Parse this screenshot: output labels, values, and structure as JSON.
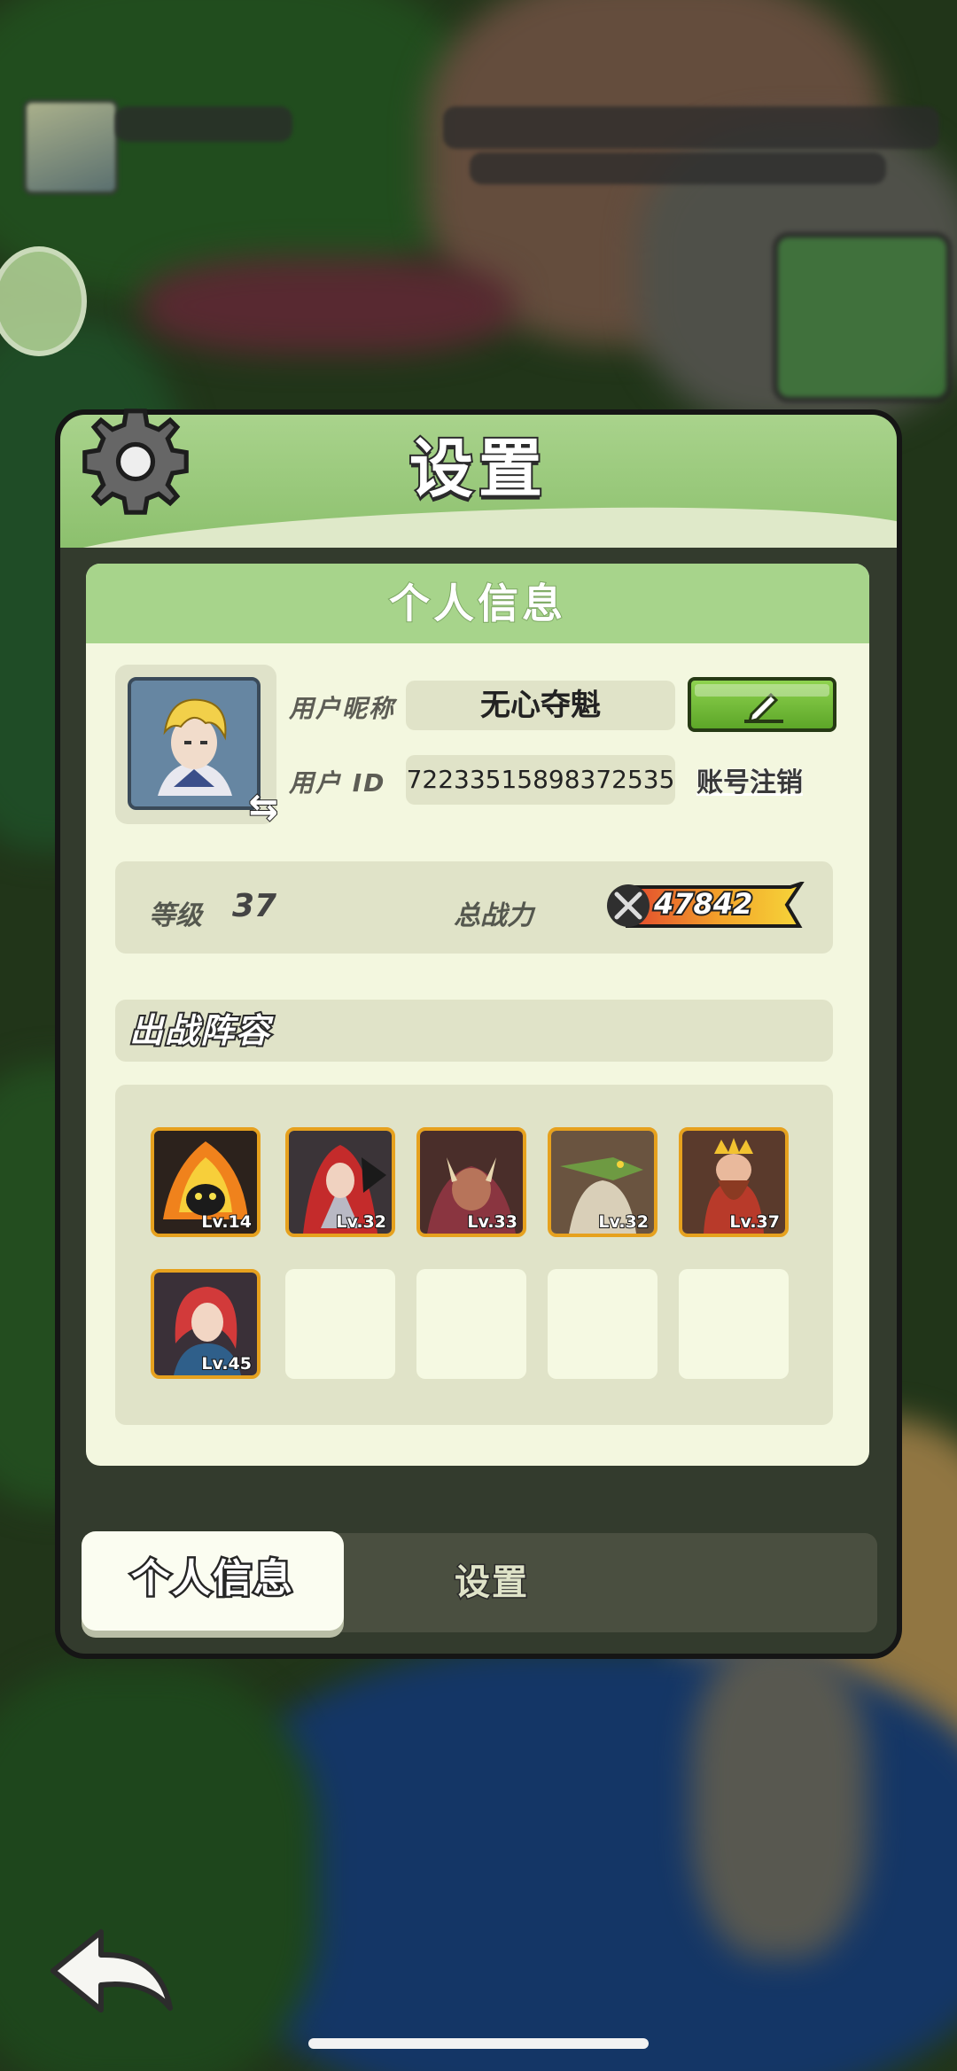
{
  "panel": {
    "title": "设置"
  },
  "profile": {
    "section_title": "个人信息",
    "nickname_label": "用户昵称",
    "nickname": "无心夺魁",
    "id_label": "用户  ID",
    "user_id": "72233515898372535",
    "cancel_account_label": "账号注销"
  },
  "stats": {
    "level_label": "等级",
    "level": "37",
    "power_label": "总战力",
    "power": "47842"
  },
  "team": {
    "title": "出战阵容",
    "heroes": [
      {
        "level": "Lv.14",
        "name": "fire-demon"
      },
      {
        "level": "Lv.32",
        "name": "red-hood-knight"
      },
      {
        "level": "Lv.33",
        "name": "horned-beast"
      },
      {
        "level": "Lv.32",
        "name": "crocodile-warrior"
      },
      {
        "level": "Lv.37",
        "name": "dwarf-king"
      },
      {
        "level": "Lv.45",
        "name": "red-haired-mage"
      }
    ],
    "empty_slots": 4
  },
  "tabs": {
    "active": "个人信息",
    "other": "设置"
  },
  "colors": {
    "header_green": "#a9d38c",
    "card_bg": "#f3f7df",
    "hero_border": "#e6a11e",
    "edit_button": "#6fbf34"
  },
  "icons": [
    "gear-icon",
    "pencil-icon",
    "swap-icon",
    "crossed-swords-icon",
    "back-arrow-icon"
  ]
}
